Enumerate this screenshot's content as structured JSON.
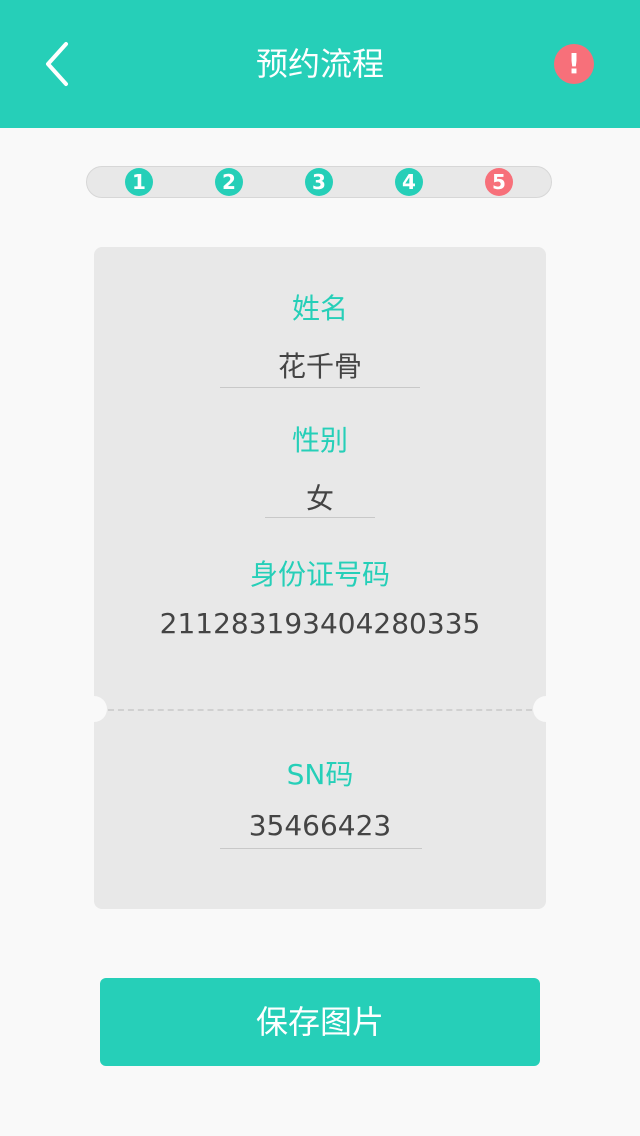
{
  "header": {
    "title": "预约流程",
    "back_icon": "chevron-left-icon",
    "alert_icon": "exclamation-icon",
    "alert_label": "!",
    "background_color": "#26cfb8",
    "alert_color": "#f7707a"
  },
  "steps": {
    "items": [
      {
        "label": "1",
        "status": "done"
      },
      {
        "label": "2",
        "status": "done"
      },
      {
        "label": "3",
        "status": "done"
      },
      {
        "label": "4",
        "status": "done"
      },
      {
        "label": "5",
        "status": "current"
      }
    ],
    "done_color": "#26cfb8",
    "current_color": "#f7707a"
  },
  "card": {
    "name_label": "姓名",
    "name_value": "花千骨",
    "gender_label": "性别",
    "gender_value": "女",
    "id_label": "身份证号码",
    "id_value": "211283193404280335",
    "sn_label": "SN码",
    "sn_value": "35466423"
  },
  "actions": {
    "save_label": "保存图片"
  }
}
